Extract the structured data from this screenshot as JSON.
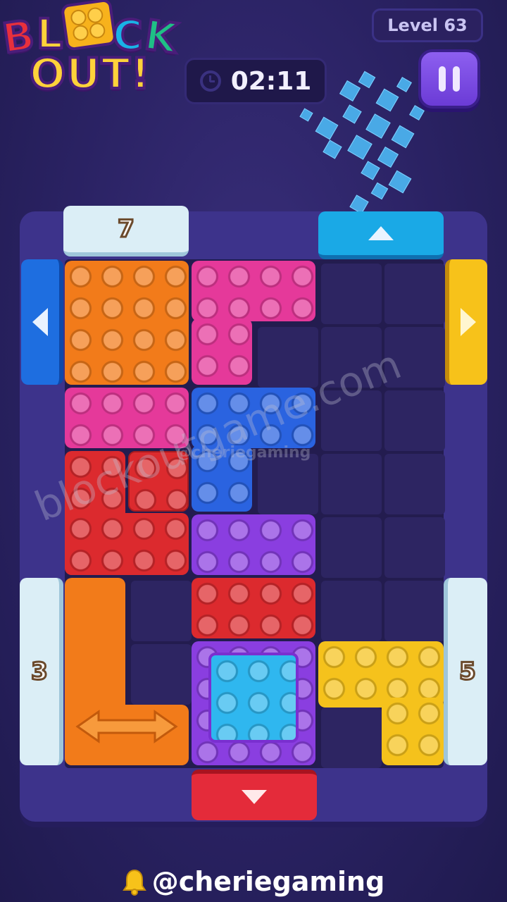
{
  "logo": {
    "line1": [
      "B",
      "L",
      "C",
      "K"
    ],
    "line2": "OUT!"
  },
  "level": {
    "label": "Level 63"
  },
  "timer": {
    "time": "02:11"
  },
  "gates": {
    "top_left_number": "7",
    "left_number": "3",
    "right_number": "5"
  },
  "colors": {
    "orange": "#f27b1a",
    "pink": "#e5399a",
    "blue": "#2a63e0",
    "red": "#dc2a2e",
    "purple": "#8a3ee0",
    "yellow": "#f5c21c",
    "cyan": "#2fb7ef",
    "gate_light": "#dff0f7",
    "gate_blue": "#1aa9e6",
    "gate_yellow": "#f7c21a",
    "gate_red": "#e42b3a"
  },
  "watermarks": {
    "site": "blockoutgame.com",
    "handle_small": "@cheriegaming"
  },
  "footer": {
    "handle": "@cheriegaming",
    "icon": "bell-icon"
  }
}
